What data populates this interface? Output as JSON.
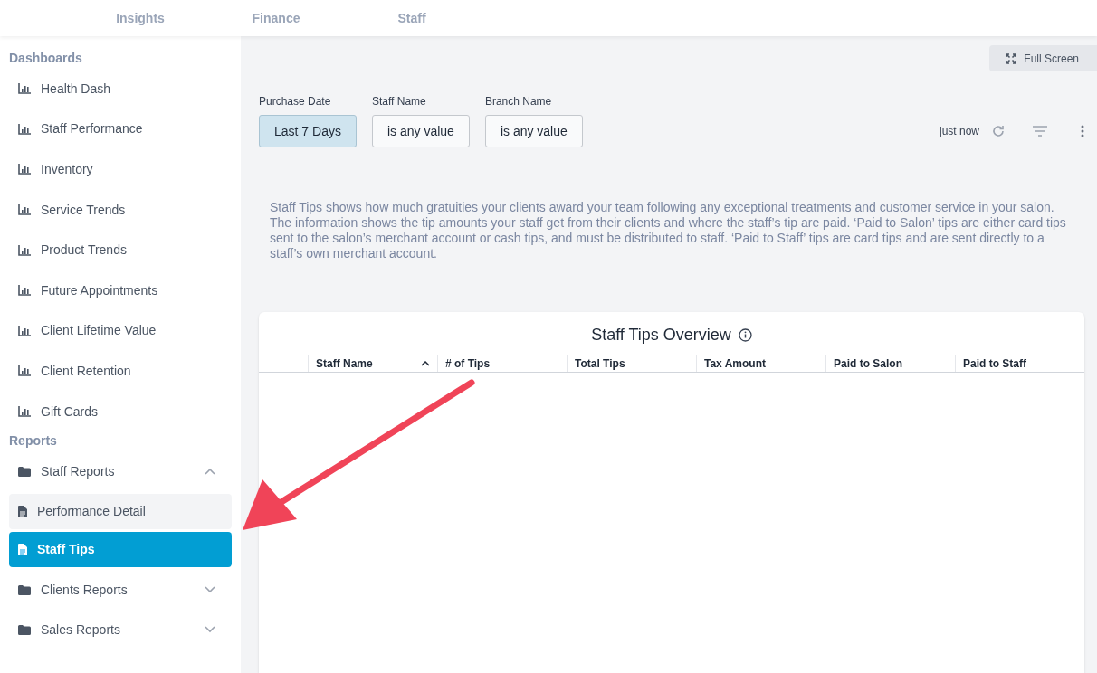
{
  "top_tabs": [
    {
      "label": "Insights",
      "selected": false
    },
    {
      "label": "Finance",
      "selected": false
    },
    {
      "label": "Staff",
      "selected": false
    }
  ],
  "sidebar": {
    "sections": [
      {
        "title": "Dashboards",
        "items": [
          {
            "kind": "dashboard",
            "label": "Health Dash"
          },
          {
            "kind": "dashboard",
            "label": "Staff Performance"
          },
          {
            "kind": "dashboard",
            "label": "Inventory"
          },
          {
            "kind": "dashboard",
            "label": "Service Trends"
          },
          {
            "kind": "dashboard",
            "label": "Product Trends"
          },
          {
            "kind": "dashboard",
            "label": "Future Appointments"
          },
          {
            "kind": "dashboard",
            "label": "Client Lifetime Value"
          },
          {
            "kind": "dashboard",
            "label": "Client Retention"
          },
          {
            "kind": "dashboard",
            "label": "Gift Cards"
          }
        ]
      },
      {
        "title": "Reports",
        "items": [
          {
            "kind": "folder",
            "label": "Staff Reports",
            "expanded": true,
            "children": [
              {
                "label": "Performance Detail",
                "selected": false,
                "hovered": true
              },
              {
                "label": "Staff Tips",
                "selected": true
              }
            ]
          },
          {
            "kind": "folder",
            "label": "Clients Reports",
            "expanded": false
          },
          {
            "kind": "folder",
            "label": "Sales Reports",
            "expanded": false
          }
        ]
      }
    ]
  },
  "full_screen_button": "Full Screen",
  "filters": [
    {
      "label": "Purchase Date",
      "value": "Last 7 Days",
      "active": true
    },
    {
      "label": "Staff Name",
      "value": "is any value",
      "active": false
    },
    {
      "label": "Branch Name",
      "value": "is any value",
      "active": false
    }
  ],
  "updated": "just now",
  "description": "Staff Tips shows how much gratuities your clients award your team following any exceptional treatments and customer service in your salon. The information shows the tip amounts your staff get from their clients and where the staff’s tip are paid. ‘Paid to Salon’ tips are either card tips sent to the salon’s merchant account or cash tips, and must be distributed to staff. ‘Paid to Staff’ tips are card tips and are sent directly to a staff’s own merchant account.",
  "table": {
    "title": "Staff Tips Overview",
    "columns": [
      {
        "label": "Staff Name",
        "sorted": true
      },
      {
        "label": "# of Tips",
        "sorted": false
      },
      {
        "label": "Total Tips",
        "sorted": false
      },
      {
        "label": "Tax Amount",
        "sorted": false
      },
      {
        "label": "Paid to Salon",
        "sorted": false
      },
      {
        "label": "Paid to Staff",
        "sorted": false
      }
    ]
  }
}
